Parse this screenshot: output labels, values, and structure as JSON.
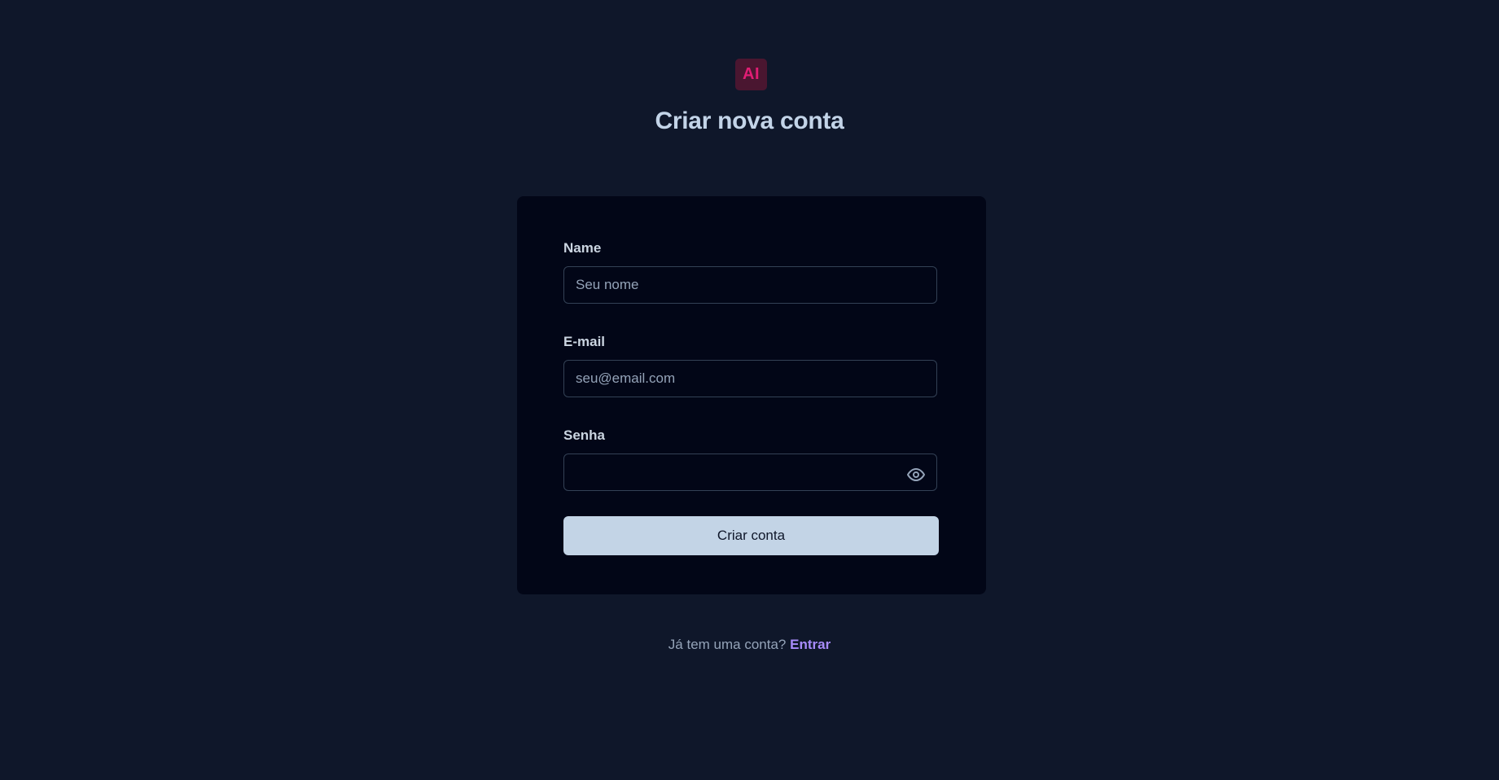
{
  "logo": {
    "text": "AI",
    "text_color": "#e11d74",
    "background_color": "#4a1630"
  },
  "title": "Criar nova conta",
  "title_color": "#c3d4e8",
  "form": {
    "name": {
      "label": "Name",
      "placeholder": "Seu nome",
      "value": ""
    },
    "email": {
      "label": "E-mail",
      "placeholder": "seu@email.com",
      "value": ""
    },
    "password": {
      "label": "Senha",
      "placeholder": "",
      "value": "",
      "toggle_icon": "eye-icon"
    },
    "submit_label": "Criar conta",
    "submit_color": "#c3d4e6"
  },
  "footer": {
    "prompt": "Já tem uma conta?",
    "link_label": "Entrar",
    "link_color": "#a78bfa"
  }
}
